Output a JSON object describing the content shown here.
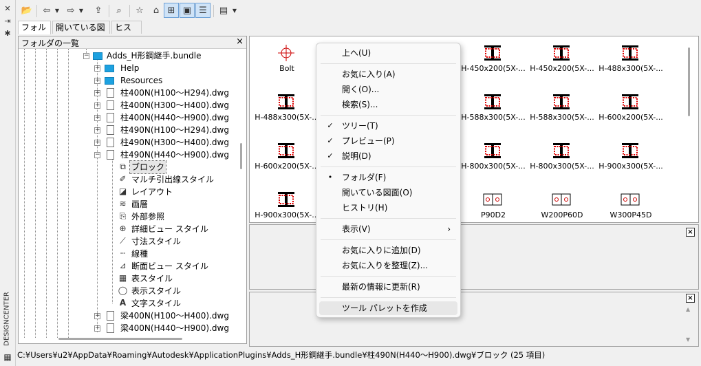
{
  "palette": {
    "title": "DESIGNCENTER"
  },
  "toolbar": {
    "buttons": [
      "load-icon",
      "back-icon",
      "dropdown-arrow-icon",
      "forward-icon",
      "dropdown-arrow-icon",
      "up-icon",
      "search-icon",
      "favorites-icon",
      "home-icon",
      "tree-toggle-icon",
      "preview-icon",
      "description-icon",
      "views-icon",
      "dropdown-arrow-icon"
    ]
  },
  "tabs": [
    "フォルダ",
    "開いている図面",
    "ヒストリ"
  ],
  "tree": {
    "header": "フォルダの一覧",
    "close": "×",
    "items": [
      "Adds_H形鋼継手.bundle",
      "Help",
      "Resources",
      "柱400N(H100〜H294).dwg",
      "柱400N(H300〜H400).dwg",
      "柱400N(H440〜H900).dwg",
      "柱490N(H100〜H294).dwg",
      "柱490N(H300〜H400).dwg",
      "柱490N(H440〜H900).dwg",
      "ブロック",
      "マルチ引出線スタイル",
      "レイアウト",
      "画層",
      "外部参照",
      "詳細ビュー スタイル",
      "寸法スタイル",
      "線種",
      "断面ビュー スタイル",
      "表スタイル",
      "表示スタイル",
      "文字スタイル",
      "梁400N(H100〜H400).dwg",
      "梁400N(H440〜H900).dwg"
    ]
  },
  "preview": {
    "items": [
      "Bolt",
      "",
      "",
      "H-450x200(5X-...",
      "H-450x200(5X-...",
      "H-488x300(5X-...",
      "H-488x300(5X-...",
      "",
      "",
      "H-588x300(5X-...",
      "H-588x300(5X-...",
      "H-600x200(5X-...",
      "H-600x200(5X-...",
      "",
      "",
      "H-800x300(5X-...",
      "H-800x300(5X-...",
      "H-900x300(5X-...",
      "H-900x300(5X-...",
      "",
      "",
      "P90D2",
      "W200P60D",
      "W300P45D"
    ]
  },
  "panels": {
    "close": "×"
  },
  "status": "C:¥Users¥u2¥AppData¥Roaming¥Autodesk¥ApplicationPlugins¥Adds_H形鋼継手.bundle¥柱490N(H440〜H900).dwg¥ブロック (25 項目)",
  "context_menu": {
    "items": [
      {
        "label": "上へ(U)"
      },
      {
        "label": "お気に入り(A)"
      },
      {
        "label": "開く(O)..."
      },
      {
        "label": "検索(S)..."
      },
      {
        "label": "ツリー(T)",
        "mark": "✓"
      },
      {
        "label": "プレビュー(P)",
        "mark": "✓"
      },
      {
        "label": "説明(D)",
        "mark": "✓"
      },
      {
        "label": "フォルダ(F)",
        "mark": "•"
      },
      {
        "label": "開いている図面(O)"
      },
      {
        "label": "ヒストリ(H)"
      },
      {
        "label": "表示(V)",
        "submenu": "›"
      },
      {
        "label": "お気に入りに追加(D)"
      },
      {
        "label": "お気に入りを整理(Z)..."
      },
      {
        "label": "最新の情報に更新(R)"
      },
      {
        "label": "ツール パレットを作成"
      }
    ]
  }
}
